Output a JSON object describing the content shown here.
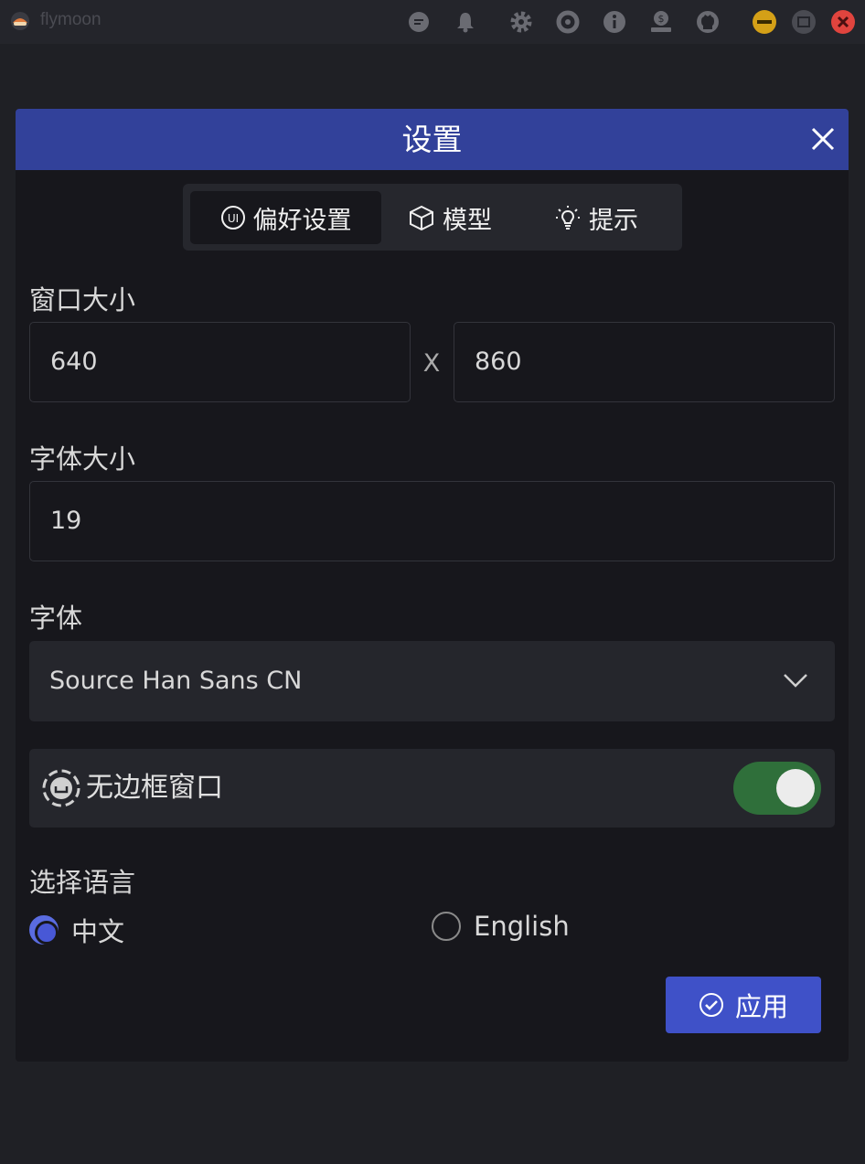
{
  "app": {
    "name": "flymoon"
  },
  "titlebar": {
    "icons": [
      "chat-icon",
      "bell-icon",
      "gear-icon",
      "lifebuoy-icon",
      "info-icon",
      "donate-icon",
      "github-icon",
      "minimize-icon",
      "maximize-icon",
      "close-icon"
    ],
    "colors": {
      "minimize": "#d4a017",
      "maximize": "#4a4b52",
      "close": "#e0443e"
    }
  },
  "dialog": {
    "title": "设置",
    "header_color": "#32419a",
    "tabs": [
      {
        "label": "偏好设置",
        "icon": "ui-icon",
        "active": true
      },
      {
        "label": "模型",
        "icon": "cube-icon",
        "active": false
      },
      {
        "label": "提示",
        "icon": "lightbulb-icon",
        "active": false
      }
    ],
    "window_size": {
      "label": "窗口大小",
      "width": "640",
      "separator": "X",
      "height": "860"
    },
    "font_size": {
      "label": "字体大小",
      "value": "19"
    },
    "font": {
      "label": "字体",
      "selected": "Source Han Sans CN"
    },
    "frameless": {
      "label": "无边框窗口",
      "enabled": true,
      "on_color": "#2f6f3a"
    },
    "language": {
      "label": "选择语言",
      "options": [
        {
          "label": "中文",
          "checked": true
        },
        {
          "label": "English",
          "checked": false
        }
      ]
    },
    "apply_label": "应用",
    "accent_color": "#3f51c8"
  }
}
